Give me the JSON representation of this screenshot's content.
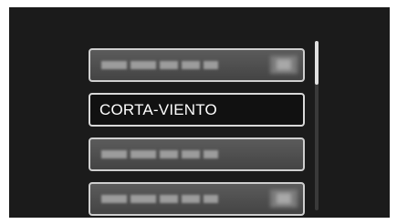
{
  "menu": {
    "items": [
      {
        "label": "",
        "blurred": true,
        "has_icon": true
      },
      {
        "label": "CORTA-VIENTO",
        "blurred": false,
        "selected": true,
        "has_icon": false
      },
      {
        "label": "",
        "blurred": true,
        "has_icon": false
      },
      {
        "label": "",
        "blurred": true,
        "has_icon": true
      }
    ]
  },
  "scrollbar": {
    "position_fraction": 0.0,
    "visible_fraction": 0.26
  },
  "colors": {
    "screen_bg": "#1b1b1b",
    "item_bg": "#505050",
    "selected_bg": "#111111",
    "border": "#cfcfcf"
  },
  "icons": {
    "item_icon": "menu-item-icon"
  }
}
